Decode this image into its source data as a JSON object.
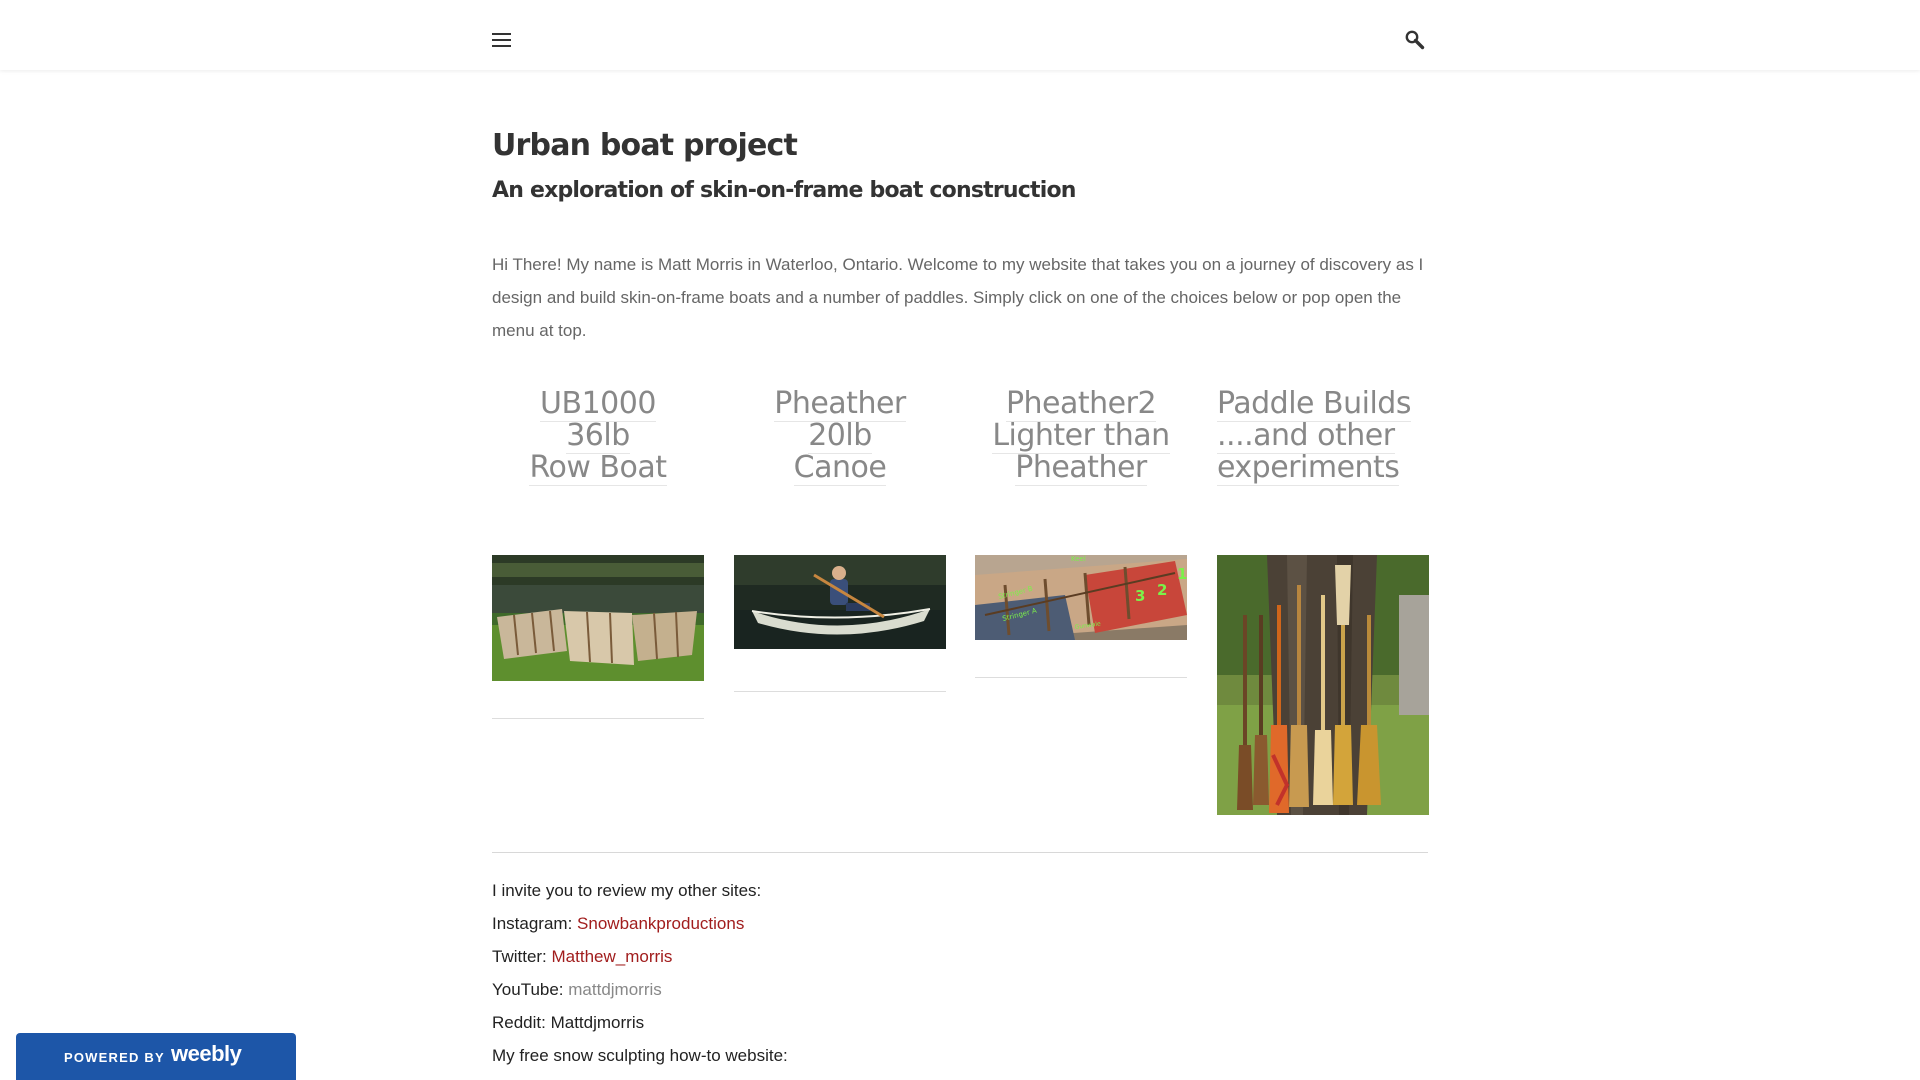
{
  "header": {
    "menu_icon": "hamburger-menu-icon",
    "search_icon": "search-icon"
  },
  "site": {
    "title": "Urban boat project",
    "subtitle": "An exploration of skin-on-frame boat construction",
    "intro": "Hi There! My name is Matt Morris in Waterloo, Ontario. Welcome to my website that takes you on a journey of discovery as I design and build skin-on-frame boats and a number of paddles. Simply click on one of the choices below or pop open the menu at top."
  },
  "projects": [
    {
      "lines": [
        "UB1000",
        "36lb",
        "Row Boat"
      ],
      "image": "Three skin-on-frame row boat frames on grass by a pond"
    },
    {
      "lines": [
        "Pheather",
        "20lb",
        "Canoe"
      ],
      "image": "Person paddling a translucent skin canoe on dark water"
    },
    {
      "lines": [
        "Pheather2",
        "Lighter than",
        "Pheather"
      ],
      "image": "Annotated boat frame with keel and stringer labels"
    },
    {
      "lines": [
        "Paddle Builds",
        "....and other",
        "experiments"
      ],
      "image": "Collection of handmade wooden paddles leaning on a tree"
    }
  ],
  "frame_labels": {
    "keel": "Keel",
    "stringer_b": "Stringer B",
    "stringer_a": "Stringer A",
    "gunwale": "Gunwale",
    "n3": "3",
    "n2": "2",
    "n1": "1"
  },
  "other_sites": {
    "intro": "I invite you to review my other sites:",
    "instagram_label": "Instagram: ",
    "instagram_link": "Snowbankproductions",
    "twitter_label": "Twitter: ",
    "twitter_link": "Matthew_morris",
    "youtube_label": "YouTube: ",
    "youtube_link": "mattdjmorris",
    "reddit": "Reddit: Mattdjmorris",
    "snow": "My free snow sculpting how-to website:"
  },
  "badge": {
    "powered_by": "POWERED BY",
    "brand": "weebly"
  },
  "colors": {
    "link_red": "#a11d1d",
    "link_grey": "#888888",
    "badge_blue": "#1d56a8"
  }
}
